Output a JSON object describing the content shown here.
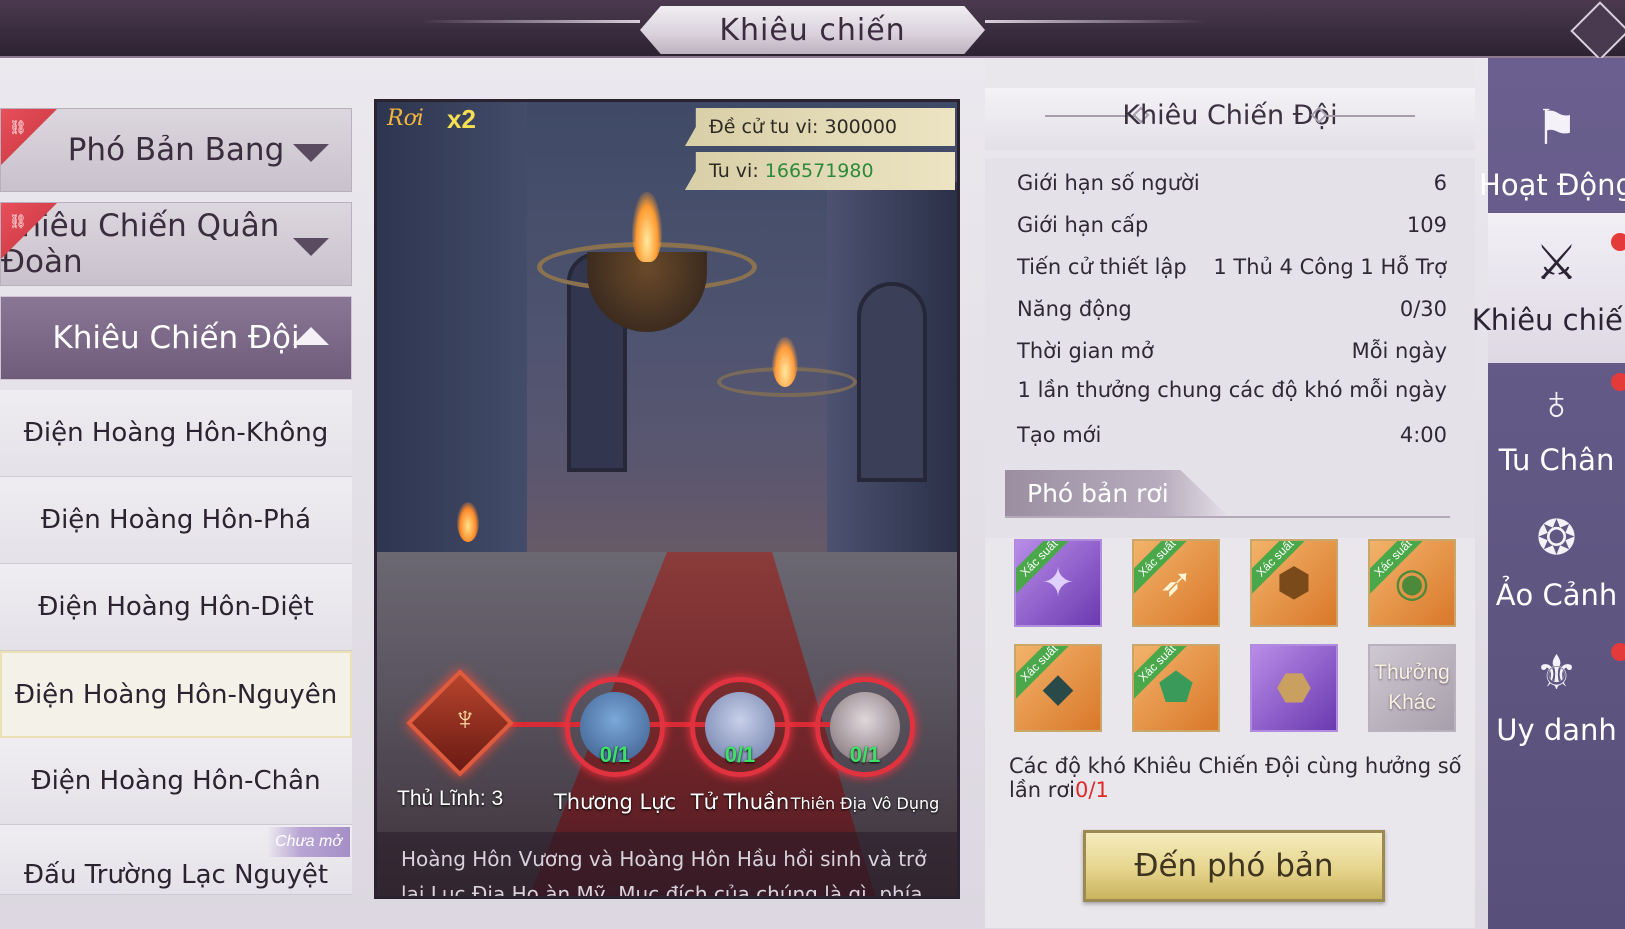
{
  "header": {
    "title": "Khiêu chiến"
  },
  "left_menu": {
    "categories": [
      {
        "label": "Phó Bản Bang"
      },
      {
        "label": "Khiêu Chiến Quân Đoàn"
      },
      {
        "label": "Khiêu Chiến Đội"
      }
    ],
    "items": [
      {
        "label": "Điện Hoàng Hôn-Không"
      },
      {
        "label": "Điện Hoàng Hôn-Phá"
      },
      {
        "label": "Điện Hoàng Hôn-Diệt"
      },
      {
        "label": "Điện Hoàng Hôn-Nguyên"
      },
      {
        "label": "Điện Hoàng Hôn-Chân"
      },
      {
        "label": "Đấu Trường Lạc Nguyệt",
        "tag": "Chưa mở"
      }
    ]
  },
  "scene": {
    "drop_label": "Rơi",
    "drop_multiplier": "x2",
    "recommended_label": "Đề cử tu vi:",
    "recommended_value": "300000",
    "power_label": "Tu vi:",
    "power_value": "166571980",
    "boss_label": "Thủ Lĩnh: 3",
    "heroes": [
      {
        "name": "Thương Lực",
        "count": "0/1"
      },
      {
        "name": "Tử Thuần",
        "count": "0/1"
      },
      {
        "name": "Thiên Địa Vô Dụng",
        "count": "0/1"
      }
    ],
    "description": "Hoàng Hôn Vương và Hoàng Hôn Hầu hồi sinh và trở lại Lục Địa Ho àn Mỹ. Mục đích của chúng là gì, phía sau lại có ẩn tình gì?"
  },
  "info": {
    "title": "Khiêu Chiến Đội",
    "rows": [
      {
        "label": "Giới hạn số người",
        "value": "6"
      },
      {
        "label": "Giới hạn cấp",
        "value": "109"
      },
      {
        "label": "Tiến cử thiết lập",
        "value": "1 Thủ 4 Công 1 Hỗ Trợ"
      },
      {
        "label": "Năng động",
        "value": "0/30"
      },
      {
        "label": "Thời gian mở",
        "value": "Mỗi ngày"
      }
    ],
    "note": "1 lần thưởng chung các độ khó mỗi ngày",
    "refresh_label": "Tạo mới",
    "refresh_value": "4:00",
    "drops_title": "Phó bản rơi",
    "chance_tag": "Xác suất",
    "other_label": "Thưởng Khác",
    "share_note": "Các độ khó Khiêu Chiến Đội cùng hưởng số lần rơi",
    "share_count": "0/1",
    "go_button": "Đến phó bản"
  },
  "right_tabs": [
    {
      "label": "Hoạt Động",
      "icon": "banner-icon"
    },
    {
      "label": "Khiêu chiến",
      "icon": "crossed-swords-icon"
    },
    {
      "label": "Tu Chân",
      "icon": "spiral-icon"
    },
    {
      "label": "Ảo Cảnh",
      "icon": "swirl-icon"
    },
    {
      "label": "Uy danh",
      "icon": "winged-sword-icon"
    }
  ],
  "colors": {
    "accent_red": "#e02a2a",
    "power_green": "#2c8a3a",
    "gold_button": "#e6d58d",
    "tab_purple": "#6a5f8e"
  }
}
